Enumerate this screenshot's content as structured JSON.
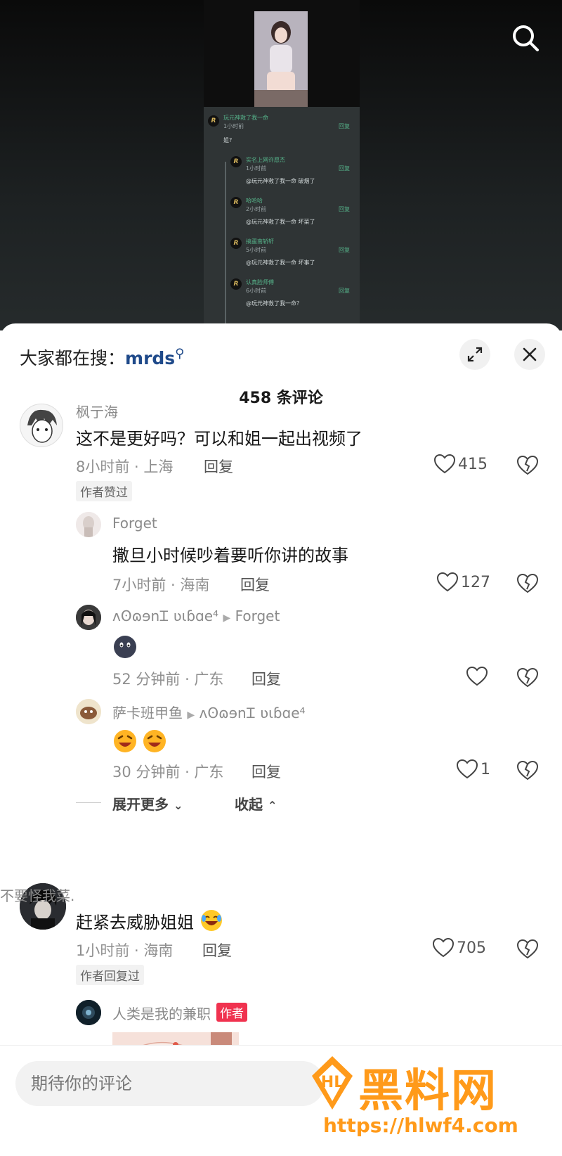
{
  "video": {
    "thumb_comments": [
      {
        "name": "玩元神救了我一命",
        "time": "1小时前",
        "body": "姐?",
        "reply": "回复"
      },
      {
        "name": "实名上网许愿杰",
        "time": "1小时前",
        "body": "@玩元神救了我一命 破烟了",
        "reply": "回复"
      },
      {
        "name": "哈哈哈",
        "time": "2小时前",
        "body": "@玩元神救了我一命 坏菜了",
        "reply": "回复"
      },
      {
        "name": "搞蛋南轿轩",
        "time": "5小时前",
        "body": "@玩元神救了我一命 坏事了",
        "reply": "回复"
      },
      {
        "name": "认真脸师傅",
        "time": "6小时前",
        "body": "@玩元神救了我一命？",
        "reply": "回复"
      }
    ]
  },
  "header": {
    "hot_search_prefix": "大家都在搜：",
    "hot_search_keyword": "mrds",
    "comment_count": "458 条评论"
  },
  "comments": [
    {
      "user": "枫亍海",
      "text": "这不是更好吗？可以和姐一起出视频了",
      "meta": "8小时前 · 上海",
      "reply": "回复",
      "likes": "415",
      "tag": "作者赞过",
      "replies": [
        {
          "user": "Forget",
          "text": "撒旦小时候吵着要听你讲的故事",
          "meta": "7小时前 · 海南",
          "reply": "回复",
          "likes": "127"
        },
        {
          "user": "ᴧʘɷɘnᏆ ʋɩɓɑe⁴",
          "to": "Forget",
          "meta": "52 分钟前 · 广东",
          "reply": "回复",
          "likes": ""
        },
        {
          "user": "萨卡班甲鱼",
          "to": "ᴧʘɷɘnᏆ ʋɩɓɑe⁴",
          "meta": "30 分钟前 · 广东",
          "reply": "回复",
          "likes": "1"
        }
      ],
      "expand_more": "展开更多",
      "collapse": "收起"
    },
    {
      "user": "不要怪我菜.",
      "text": "赶紧去威胁姐姐",
      "meta": "1小时前 · 海南",
      "reply": "回复",
      "likes": "705",
      "tag": "作者回复过",
      "replies": [
        {
          "user": "人类是我的兼职",
          "badge": "作者"
        }
      ]
    }
  ],
  "footer": {
    "input_placeholder": "期待你的评论"
  },
  "watermark": {
    "title": "黑料网",
    "url": "https://hlwf4.com"
  },
  "colors": {
    "keyword": "#1f4a8a",
    "author_badge": "#f0324f",
    "watermark": "#ff9a1a"
  }
}
